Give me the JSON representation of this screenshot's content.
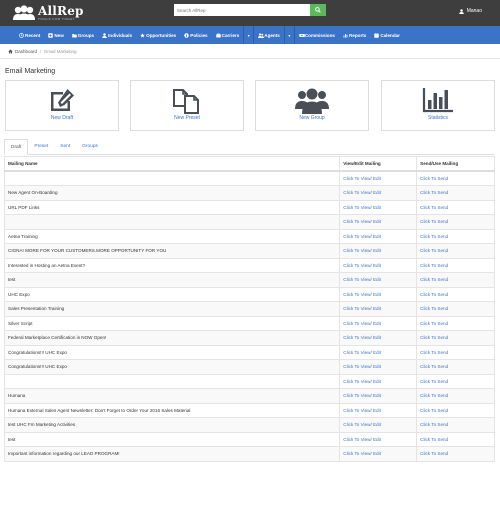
{
  "header": {
    "logo_name": "AllRep",
    "logo_tagline": "TOOLS FOR TODAY",
    "search_placeholder": "Search AllRep",
    "user_name": "Manao"
  },
  "nav": {
    "items": [
      {
        "label": "Recent",
        "icon": "history-icon"
      },
      {
        "label": "New",
        "icon": "plus-square-icon"
      },
      {
        "label": "Groups",
        "icon": "folder-icon"
      },
      {
        "label": "Individuals",
        "icon": "user-icon"
      },
      {
        "label": "Opportunities",
        "icon": "star-icon"
      },
      {
        "label": "Policies",
        "icon": "info-icon"
      },
      {
        "label": "Carriers",
        "icon": "briefcase-icon"
      },
      {
        "label": "Agents",
        "icon": "users-icon"
      },
      {
        "label": "Commissions",
        "icon": "money-icon"
      },
      {
        "label": "Reports",
        "icon": "bar-chart-icon"
      },
      {
        "label": "Calendar",
        "icon": "calendar-icon"
      }
    ]
  },
  "breadcrumb": {
    "home": "Dashboard",
    "current": "Email Marketing"
  },
  "page": {
    "title": "Email Marketing"
  },
  "tiles": [
    {
      "label": "New Draft",
      "icon": "edit-icon"
    },
    {
      "label": "New Preset",
      "icon": "copy-icon"
    },
    {
      "label": "New Group",
      "icon": "group-icon"
    },
    {
      "label": "Statistics",
      "icon": "statistics-icon"
    }
  ],
  "tabs": [
    {
      "label": "Draft",
      "active": true
    },
    {
      "label": "Preset",
      "active": false
    },
    {
      "label": "Sent",
      "active": false
    },
    {
      "label": "Groups",
      "active": false
    }
  ],
  "table": {
    "headers": [
      "Mailing Name",
      "View/Edit Mailing",
      "Send/Use Mailing"
    ],
    "view_label": "Click To View/ Edit",
    "send_label": "Click To Send",
    "rows": [
      "",
      "New Agent On-Boarding",
      "URL PDF Links",
      "",
      "Aetna Training",
      "CIGNA! MORE FOR YOUR CUSTOMERS.MORE OPPORTUNITY FOR YOU",
      "Interested in Hosting an Aetna Event?",
      "test",
      "UHC Expo",
      "Sales Presentation Training",
      "Silver Script",
      "Federal Marketplace Certification is NOW Open!",
      "Congratulations!!! UHC Expo",
      "Congratulations!!! UHC Expo",
      "",
      "Humana",
      "Humana External Sales Agent Newsletter: Don't Forget to Order Your 2016 Sales Material",
      "test UHC Fm Marketing Activities",
      "test",
      "Important information regarding our LEAD PROGRAM!"
    ]
  },
  "colors": {
    "header_bg": "#3e3e3e",
    "nav_bg": "#3b74c6",
    "accent": "#3b74c6",
    "search_button": "#5cb85c"
  }
}
